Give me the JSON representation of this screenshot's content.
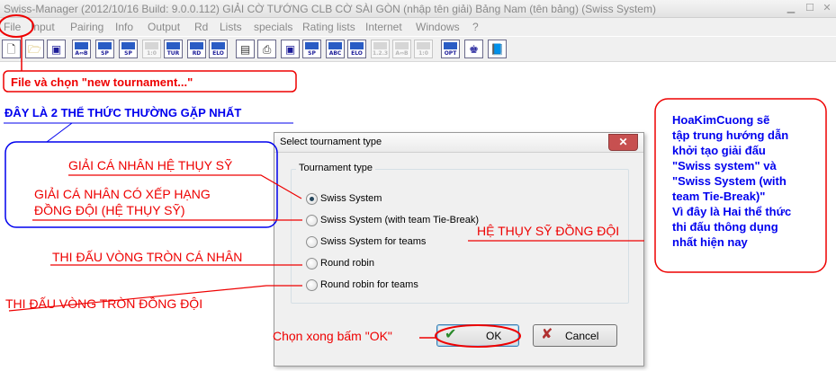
{
  "window": {
    "title": "Swiss-Manager (2012/10/16 Build: 9.0.0.112)  GIẢI CỜ TƯỚNG CLB CỜ SÀI GÒN (nhập tên giải)  Bảng Nam (tên bảng)  (Swiss System)"
  },
  "menu": [
    "File",
    "Input",
    "Pairing",
    "Info",
    "Output",
    "Rd",
    "Lists",
    "specials",
    "Rating lists",
    "Internet",
    "Windows",
    "?"
  ],
  "toolbar": [
    "A⇔B",
    "SP",
    "SP",
    "1:0",
    "TUR",
    "RD",
    "ELO",
    "SP",
    "ABC",
    "ELO",
    "1.2.3",
    "A⇔B",
    "1:0",
    "OPT"
  ],
  "dialog": {
    "title": "Select tournament type",
    "group_label": "Tournament type",
    "options": [
      {
        "label": "Swiss System",
        "selected": true
      },
      {
        "label": "Swiss System (with team Tie-Break)",
        "selected": false
      },
      {
        "label": "Swiss System for teams",
        "selected": false
      },
      {
        "label": "Round robin",
        "selected": false
      },
      {
        "label": "Round robin for teams",
        "selected": false
      }
    ],
    "ok_label": "OK",
    "cancel_label": "Cancel"
  },
  "annotations": {
    "file_hint": "File và chọn \"new tournament...\"",
    "common_formats": "ĐÂY LÀ 2 THỂ THỨC THƯỜNG GẶP NHẤT",
    "swiss_individual": "GIẢI CÁ NHÂN HỆ THỤY SỸ",
    "swiss_team_rank_line1": "GIẢI CÁ NHÂN CÓ XẾP HẠNG",
    "swiss_team_rank_line2": "ĐỒNG ĐỘI (HỆ THỤY SỸ)",
    "swiss_teams": "HỆ THỤY SỸ ĐỒNG ĐỘI",
    "rr_individual": "THI ĐẤU VÒNG TRÒN CÁ NHÂN",
    "rr_teams": "THI ĐẤU VÒNG TRÒN ĐỒNG ĐỘI",
    "choose_ok": "Chọn xong bấm \"OK\"",
    "note": [
      "HoaKimCuong sẽ",
      "tập trung hướng dẫn",
      "khởi tạo giải đấu",
      "\"Swiss system\" và",
      "\"Swiss System (with",
      "team Tie-Break)\"",
      "Vì đây là Hai thể thức",
      "thi đấu thông dụng",
      "nhất hiện nay"
    ]
  },
  "colors": {
    "annotation_red": "#ee0000",
    "annotation_blue": "#0000ee",
    "dialog_bg": "#f0f0f0"
  }
}
